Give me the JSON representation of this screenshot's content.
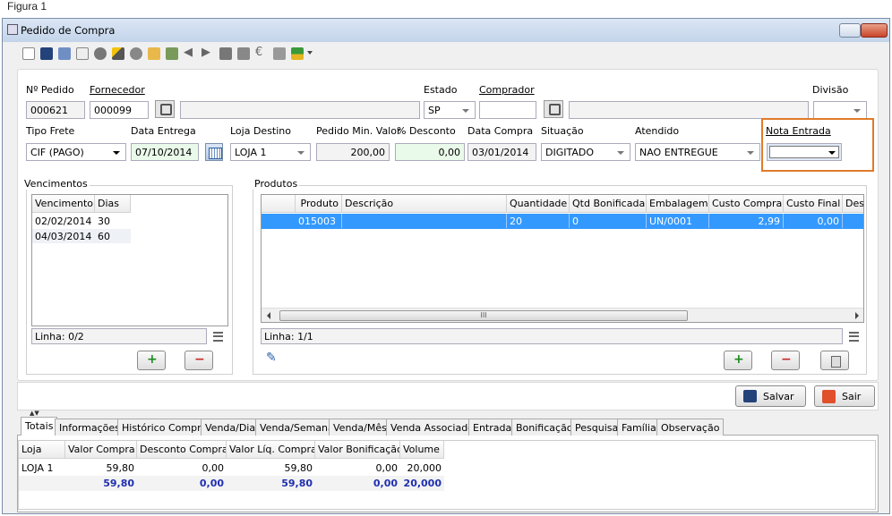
{
  "figure_caption": "Figura 1",
  "window": {
    "title": "Pedido de Compra"
  },
  "toolbar": {
    "icons": [
      "new-icon",
      "save-icon",
      "print-icon",
      "copy-icon",
      "undo-icon",
      "wand-icon",
      "gear-icon",
      "report-icon",
      "transfer-icon",
      "prev-icon",
      "next-icon",
      "people-icon",
      "send-icon",
      "euro-icon",
      "stop-icon",
      "download-icon"
    ]
  },
  "header": {
    "numero_pedido": {
      "label": "Nº Pedido",
      "value": "000621"
    },
    "fornecedor": {
      "label": "Fornecedor",
      "code": "000099",
      "name": ""
    },
    "estado": {
      "label": "Estado",
      "value": "SP"
    },
    "comprador": {
      "label": "Comprador",
      "code": "",
      "name": ""
    },
    "divisao": {
      "label": "Divisão",
      "value": ""
    },
    "tipo_frete": {
      "label": "Tipo Frete",
      "value": "CIF (PAGO)"
    },
    "data_entrega": {
      "label": "Data Entrega",
      "value": "07/10/2014"
    },
    "loja_destino": {
      "label": "Loja Destino",
      "value": "LOJA 1"
    },
    "pedido_min_valor": {
      "label": "Pedido Min. Valor",
      "value": "200,00"
    },
    "desconto": {
      "label": "% Desconto",
      "value": "0,00"
    },
    "data_compra": {
      "label": "Data Compra",
      "value": "03/01/2014"
    },
    "situacao": {
      "label": "Situação",
      "value": "DIGITADO"
    },
    "atendido": {
      "label": "Atendido",
      "value": "NAO ENTREGUE"
    },
    "nota_entrada": {
      "label": "Nota Entrada",
      "value": ""
    }
  },
  "vencimentos": {
    "title": "Vencimentos",
    "columns": [
      "Vencimento",
      "Dias"
    ],
    "rows": [
      [
        "02/02/2014",
        "30"
      ],
      [
        "04/03/2014",
        "60"
      ]
    ],
    "status": "Linha: 0/2"
  },
  "produtos": {
    "title": "Produtos",
    "columns": [
      "Produto",
      "Descrição",
      "Quantidade",
      "Qtd Bonificada",
      "Embalagem",
      "Custo Compra",
      "Custo Final",
      "Des"
    ],
    "rows": [
      [
        "015003",
        "",
        "20",
        "0",
        "UN/0001",
        "2,99",
        "0,00",
        ""
      ]
    ],
    "status": "Linha: 1/1",
    "scroll_grip": "III"
  },
  "actions": {
    "save_label": "Salvar",
    "exit_label": "Sair"
  },
  "tabs": [
    "Totais",
    "Informações",
    "Histórico Compra",
    "Venda/Dia",
    "Venda/Semana",
    "Venda/Mês",
    "Venda Associado",
    "Entrada",
    "Bonificação",
    "Pesquisa",
    "Família",
    "Observação"
  ],
  "totais": {
    "columns": [
      "Loja",
      "Valor Compra",
      "Desconto Compra",
      "Valor Líq. Compra",
      "Valor Bonificação",
      "Volume"
    ],
    "rows": [
      [
        "LOJA 1",
        "59,80",
        "0,00",
        "59,80",
        "0,00",
        "20,000"
      ]
    ],
    "total_row": [
      "",
      "59,80",
      "0,00",
      "59,80",
      "0,00",
      "20,000"
    ]
  },
  "colors": {
    "selection": "#3399ff",
    "totals_text": "#1f2fb0",
    "highlight_border": "#e07b2a"
  }
}
